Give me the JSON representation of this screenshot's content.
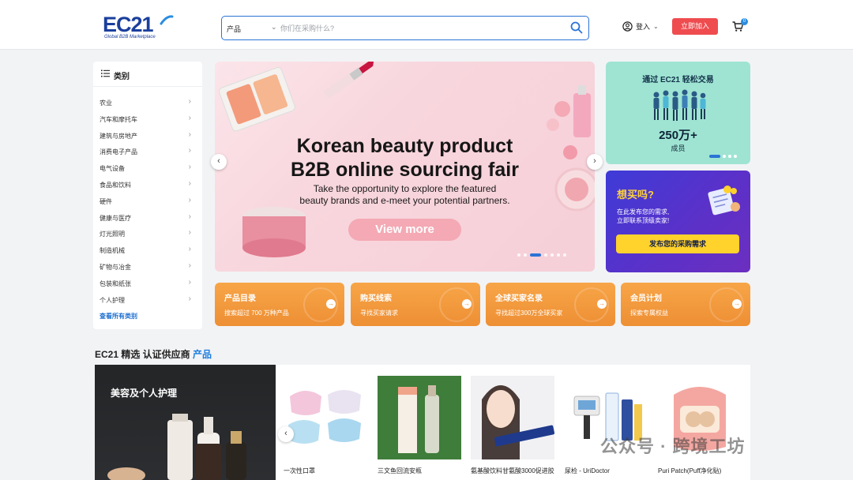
{
  "header": {
    "logo_text": "EC21",
    "logo_tagline": "Global B2B Marketplace",
    "search_category": "产品",
    "search_placeholder": "你们在采购什么?",
    "login_label": "登入",
    "join_label": "立即加入",
    "cart_count": "0"
  },
  "categories": {
    "heading": "类别",
    "items": [
      {
        "label": "农业"
      },
      {
        "label": "汽车和摩托车"
      },
      {
        "label": "建筑与房地产"
      },
      {
        "label": "消费电子产品"
      },
      {
        "label": "电气设备"
      },
      {
        "label": "食品和饮料"
      },
      {
        "label": "硬件"
      },
      {
        "label": "健康与医疗"
      },
      {
        "label": "灯光照明"
      },
      {
        "label": "制造机械"
      },
      {
        "label": "矿物与冶金"
      },
      {
        "label": "包装和纸张"
      },
      {
        "label": "个人护理"
      }
    ],
    "view_all": "查看所有类别"
  },
  "hero": {
    "title_line1": "Korean beauty product",
    "title_line2": "B2B online sourcing fair",
    "sub_line1": "Take the opportunity to explore the featured",
    "sub_line2": "beauty brands and e-meet your potential partners.",
    "cta": "View more",
    "prev_icon": "‹",
    "next_icon": "›"
  },
  "promo_top": {
    "title": "通过 EC21 轻松交易",
    "number": "250万+",
    "sub": "成员"
  },
  "promo_bottom": {
    "title": "想买吗?",
    "line1": "在此发布您的需求,",
    "line2": "立即联系顶级卖家!",
    "button": "发布您的采购需求"
  },
  "quick_cards": [
    {
      "title": "产品目录",
      "sub": "搜索超过 700 万种产品"
    },
    {
      "title": "购买线索",
      "sub": "寻找买家请求"
    },
    {
      "title": "全球买家名录",
      "sub": "寻找超过300万全球买家"
    },
    {
      "title": "会员计划",
      "sub": "探索专属权益"
    }
  ],
  "featured": {
    "title_prefix": "EC21 精选 认证供应商",
    "title_highlight": "产品",
    "panel_title": "美容及个人护理",
    "products": [
      {
        "name": "一次性口罩"
      },
      {
        "name": "三文鱼回流安瓶"
      },
      {
        "name": "氨基酸饮料甘氨酸3000促进胶"
      },
      {
        "name": "尿检 - UriDoctor"
      },
      {
        "name": "Puri Patch(Puff净化贴)"
      }
    ]
  },
  "watermark": "公众号 · 跨境工坊",
  "colors": {
    "brand_blue": "#1a3f9c",
    "accent_blue": "#2b74d6",
    "join_red": "#ef4c4f",
    "card_orange": "#ee8f34",
    "promo_mint": "#9fe4d3",
    "promo_purple": "#5a31c9",
    "cta_yellow": "#ffd22c"
  }
}
